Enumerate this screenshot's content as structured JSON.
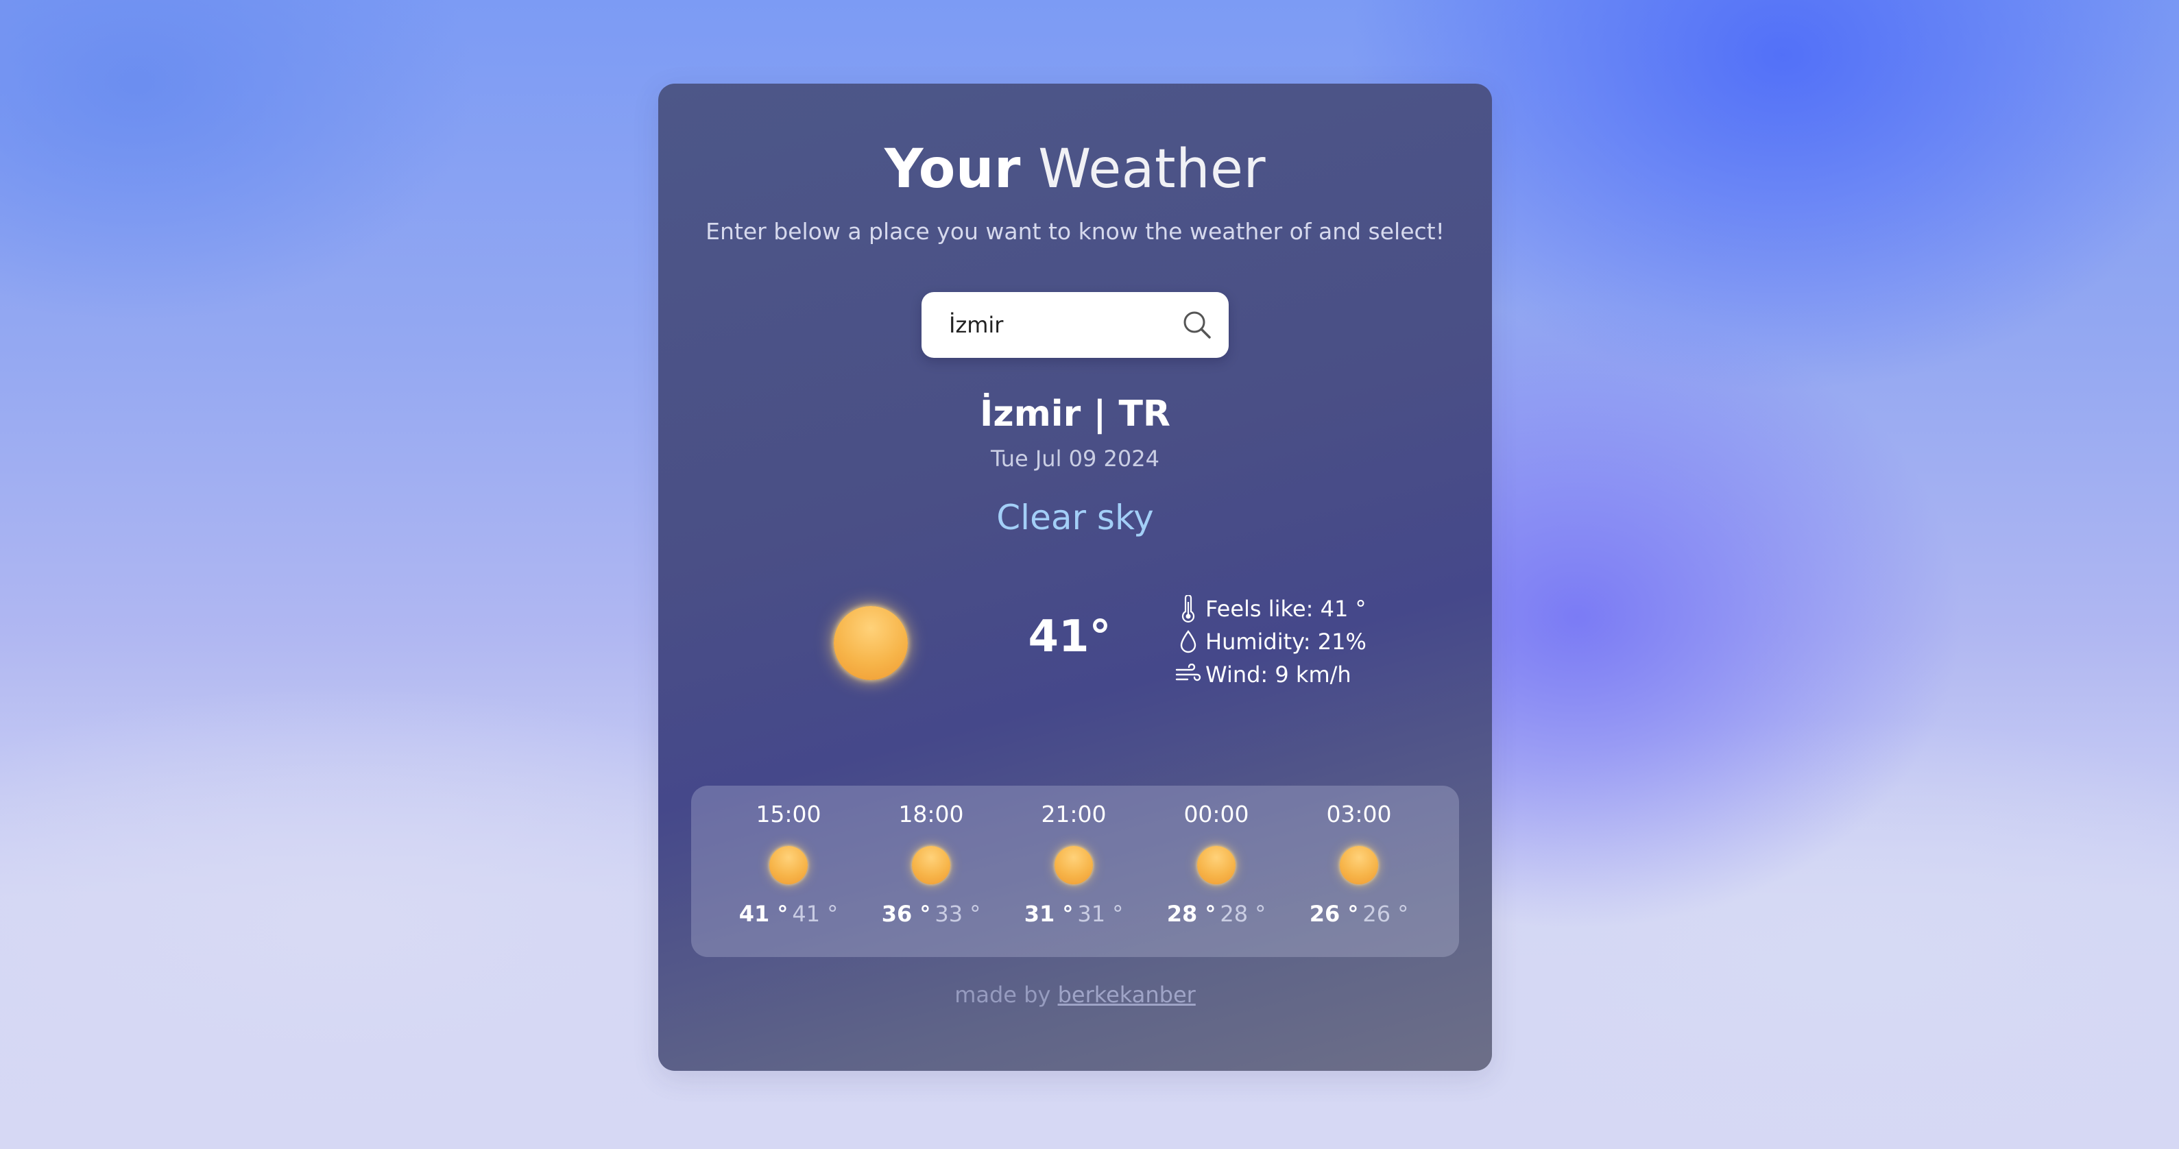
{
  "header": {
    "title_bold": "Your",
    "title_light": "Weather",
    "subtitle": "Enter below a place you want to know the weather of and select!"
  },
  "search": {
    "value": "İzmir",
    "icon": "search-icon"
  },
  "current": {
    "location": "İzmir | TR",
    "date": "Tue Jul 09 2024",
    "condition": "Clear sky",
    "condition_icon": "sun-icon",
    "temperature": "41°",
    "feels_like": "Feels like: 41 °",
    "humidity": "Humidity: 21%",
    "wind": "Wind: 9 km/h"
  },
  "forecast": [
    {
      "time": "15:00",
      "icon": "sun-icon",
      "max": "41 °",
      "min": "41 °"
    },
    {
      "time": "18:00",
      "icon": "sun-icon",
      "max": "36 °",
      "min": "33 °"
    },
    {
      "time": "21:00",
      "icon": "sun-icon",
      "max": "31 °",
      "min": "31 °"
    },
    {
      "time": "00:00",
      "icon": "sun-icon",
      "max": "28 °",
      "min": "28 °"
    },
    {
      "time": "03:00",
      "icon": "sun-icon",
      "max": "26 °",
      "min": "26 °"
    }
  ],
  "footer": {
    "prefix": "made by",
    "author": "berkekanber"
  },
  "colors": {
    "card_top": "#4d5788",
    "card_bottom": "#6d6f88",
    "condition_text": "#a3cff7",
    "sun": "#f7b54a"
  }
}
